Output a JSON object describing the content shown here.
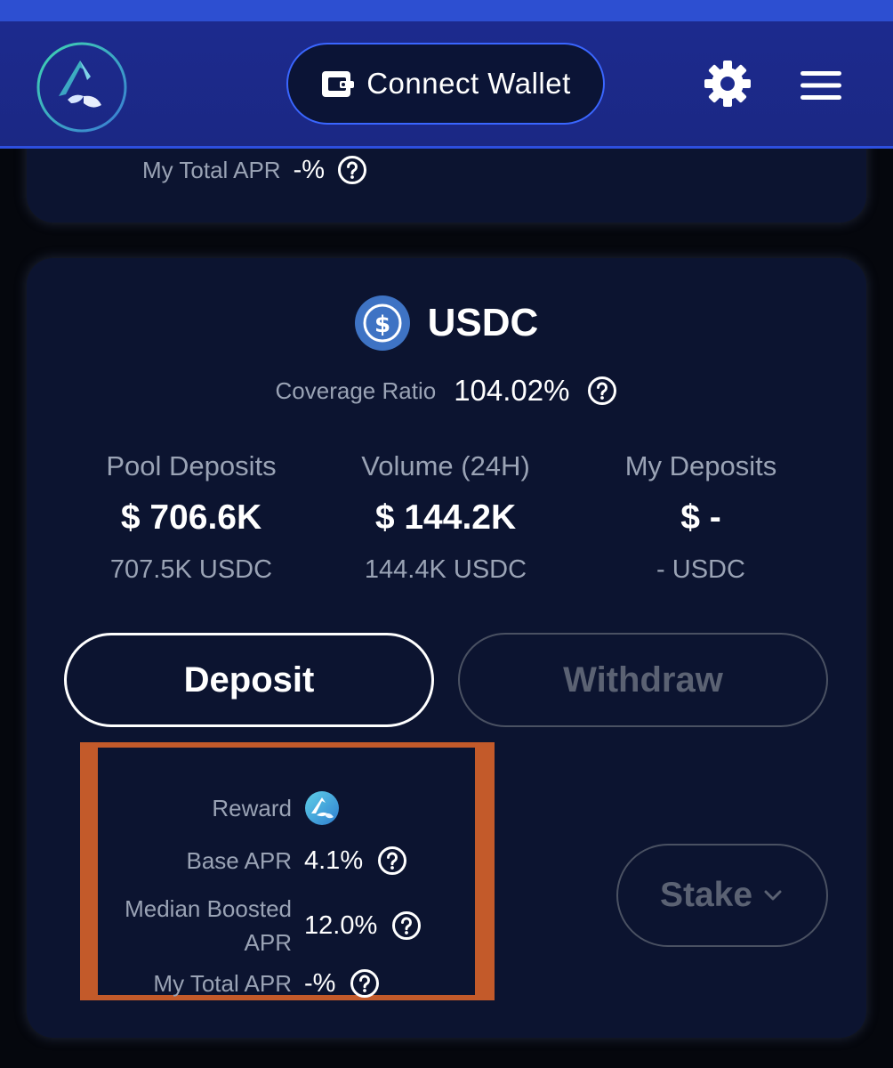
{
  "header": {
    "connect_wallet_label": "Connect Wallet"
  },
  "prev_card": {
    "my_total_apr_label": "My Total APR",
    "my_total_apr_value": "-%"
  },
  "pool": {
    "token": "USDC",
    "coverage_ratio_label": "Coverage Ratio",
    "coverage_ratio_value": "104.02%",
    "stats": [
      {
        "label": "Pool Deposits",
        "usd": "$ 706.6K",
        "amount": "707.5K USDC"
      },
      {
        "label": "Volume (24H)",
        "usd": "$ 144.2K",
        "amount": "144.4K USDC"
      },
      {
        "label": "My Deposits",
        "usd": "$ -",
        "amount": "- USDC"
      }
    ],
    "deposit_label": "Deposit",
    "withdraw_label": "Withdraw",
    "reward_label": "Reward",
    "base_apr_label": "Base APR",
    "base_apr_value": "4.1%",
    "median_boosted_apr_label_1": "Median Boosted",
    "median_boosted_apr_label_2": "APR",
    "median_boosted_apr_value": "12.0%",
    "my_total_apr_label": "My Total APR",
    "my_total_apr_value": "-%",
    "stake_label": "Stake"
  },
  "colors": {
    "navbar": "#1c2a8e",
    "card": "#0c1430",
    "highlight_border": "#c35a2a",
    "usdc_blue": "#3e73c4"
  }
}
